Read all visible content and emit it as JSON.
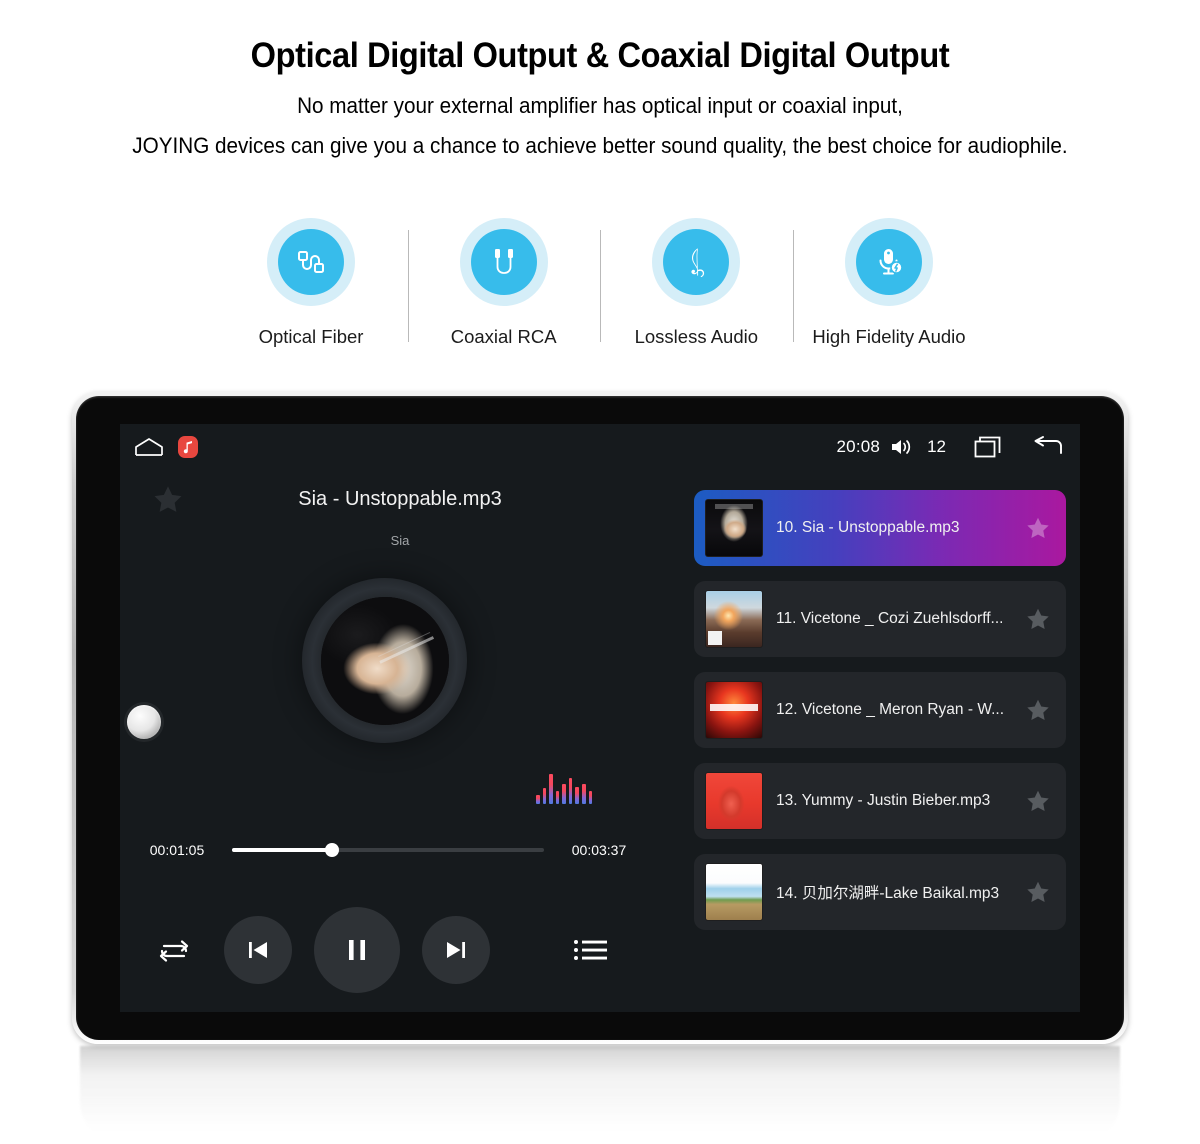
{
  "header": {
    "headline": "Optical Digital Output & Coaxial Digital Output",
    "subtitle_line1": "No matter your external amplifier has optical input or coaxial input,",
    "subtitle_line2": "JOYING devices can give you a chance to achieve better sound quality, the best choice for audiophile."
  },
  "colors": {
    "accent_blue": "#37bceb",
    "halo_blue": "#d5eef8",
    "screen_bg": "#161a1d",
    "row_bg": "#23262a",
    "active_gradient_start": "#1c5cc2",
    "active_gradient_end": "#aa189f",
    "badge_red": "#e8473f"
  },
  "features": [
    {
      "label": "Optical Fiber",
      "icon": "optical-fiber-icon"
    },
    {
      "label": "Coaxial RCA",
      "icon": "coaxial-rca-icon"
    },
    {
      "label": "Lossless Audio",
      "icon": "treble-clef-icon"
    },
    {
      "label": "High Fidelity Audio",
      "icon": "hifi-microphone-icon"
    }
  ],
  "statusbar": {
    "home_icon": "home-icon",
    "app_icon": "music-note-icon",
    "time": "20:08",
    "volume_icon": "volume-icon",
    "volume_level": "12",
    "recents_icon": "recent-apps-icon",
    "back_icon": "back-arrow-icon"
  },
  "player": {
    "favorite_icon": "star-icon",
    "track_title": "Sia - Unstoppable.mp3",
    "artist": "Sia",
    "equalizer_bars": [
      9,
      16,
      30,
      13,
      20,
      26,
      17,
      20,
      13
    ],
    "elapsed_time": "00:01:05",
    "total_time": "00:03:37",
    "progress_percent": 32,
    "controls": {
      "repeat_label": "Repeat",
      "previous_label": "Previous",
      "play_pause_label": "Pause",
      "next_label": "Next",
      "playlist_label": "Playlist"
    }
  },
  "playlist": [
    {
      "name": "10. Sia - Unstoppable.mp3",
      "art": "th-sia",
      "active": true
    },
    {
      "name": "11. Vicetone _ Cozi Zuehlsdorff...",
      "art": "th-vice1",
      "active": false
    },
    {
      "name": "12. Vicetone _ Meron Ryan - W...",
      "art": "th-vice2",
      "active": false
    },
    {
      "name": "13. Yummy - Justin Bieber.mp3",
      "art": "th-yummy",
      "active": false
    },
    {
      "name": "14. 贝加尔湖畔-Lake Baikal.mp3",
      "art": "th-baikal",
      "active": false
    }
  ]
}
